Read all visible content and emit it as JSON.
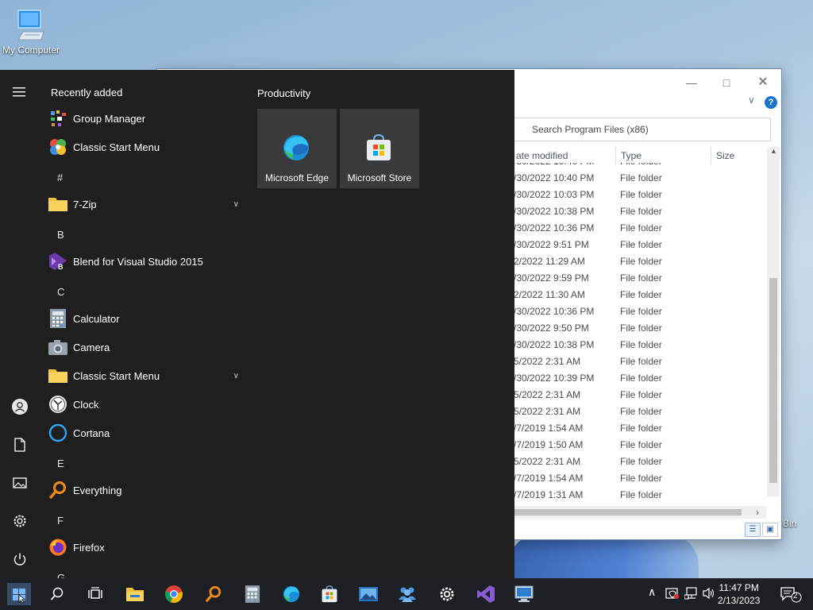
{
  "desktop": {
    "my_computer_label": "My Computer",
    "recycle_label": "Bin"
  },
  "explorer": {
    "search_placeholder": "Search Program Files (x86)",
    "columns": {
      "date": "ate modified",
      "type": "Type",
      "size": "Size"
    },
    "partial_row": {
      "date": "/30/2022 10:40 PM",
      "type": "File folder"
    },
    "rows": [
      {
        "date": "/30/2022 10:40 PM",
        "type": "File folder"
      },
      {
        "date": "/30/2022 10:03 PM",
        "type": "File folder"
      },
      {
        "date": "/30/2022 10:38 PM",
        "type": "File folder"
      },
      {
        "date": "/30/2022 10:36 PM",
        "type": "File folder"
      },
      {
        "date": "/30/2022 9:51 PM",
        "type": "File folder"
      },
      {
        "date": "2/2022 11:29 AM",
        "type": "File folder"
      },
      {
        "date": "/30/2022 9:59 PM",
        "type": "File folder"
      },
      {
        "date": "2/2022 11:30 AM",
        "type": "File folder"
      },
      {
        "date": "/30/2022 10:36 PM",
        "type": "File folder"
      },
      {
        "date": "/30/2022 9:50 PM",
        "type": "File folder"
      },
      {
        "date": "/30/2022 10:38 PM",
        "type": "File folder"
      },
      {
        "date": "5/2022 2:31 AM",
        "type": "File folder"
      },
      {
        "date": "/30/2022 10:39 PM",
        "type": "File folder"
      },
      {
        "date": "5/2022 2:31 AM",
        "type": "File folder"
      },
      {
        "date": "5/2022 2:31 AM",
        "type": "File folder"
      },
      {
        "date": "/7/2019 1:54 AM",
        "type": "File folder"
      },
      {
        "date": "/7/2019 1:50 AM",
        "type": "File folder"
      },
      {
        "date": "5/2022 2:31 AM",
        "type": "File folder"
      },
      {
        "date": "/7/2019 1:54 AM",
        "type": "File folder"
      },
      {
        "date": "/7/2019 1:31 AM",
        "type": "File folder"
      }
    ]
  },
  "start_menu": {
    "recently_added_title": "Recently added",
    "productivity_title": "Productivity",
    "apps": {
      "group_manager": "Group Manager",
      "classic_start_menu_recent": "Classic Start Menu",
      "letter_hash": "#",
      "seven_zip": "7-Zip",
      "letter_b": "B",
      "blend": "Blend for Visual Studio 2015",
      "letter_c": "C",
      "calculator": "Calculator",
      "camera": "Camera",
      "classic_start_menu_folder": "Classic Start Menu",
      "clock": "Clock",
      "cortana": "Cortana",
      "letter_e": "E",
      "everything": "Everything",
      "letter_f": "F",
      "firefox": "Firefox",
      "letter_g": "G"
    },
    "tiles": {
      "edge": "Microsoft Edge",
      "store": "Microsoft Store"
    }
  },
  "taskbar": {
    "time": "11:47 PM",
    "date": "2/13/2023",
    "notification_count": "2"
  }
}
